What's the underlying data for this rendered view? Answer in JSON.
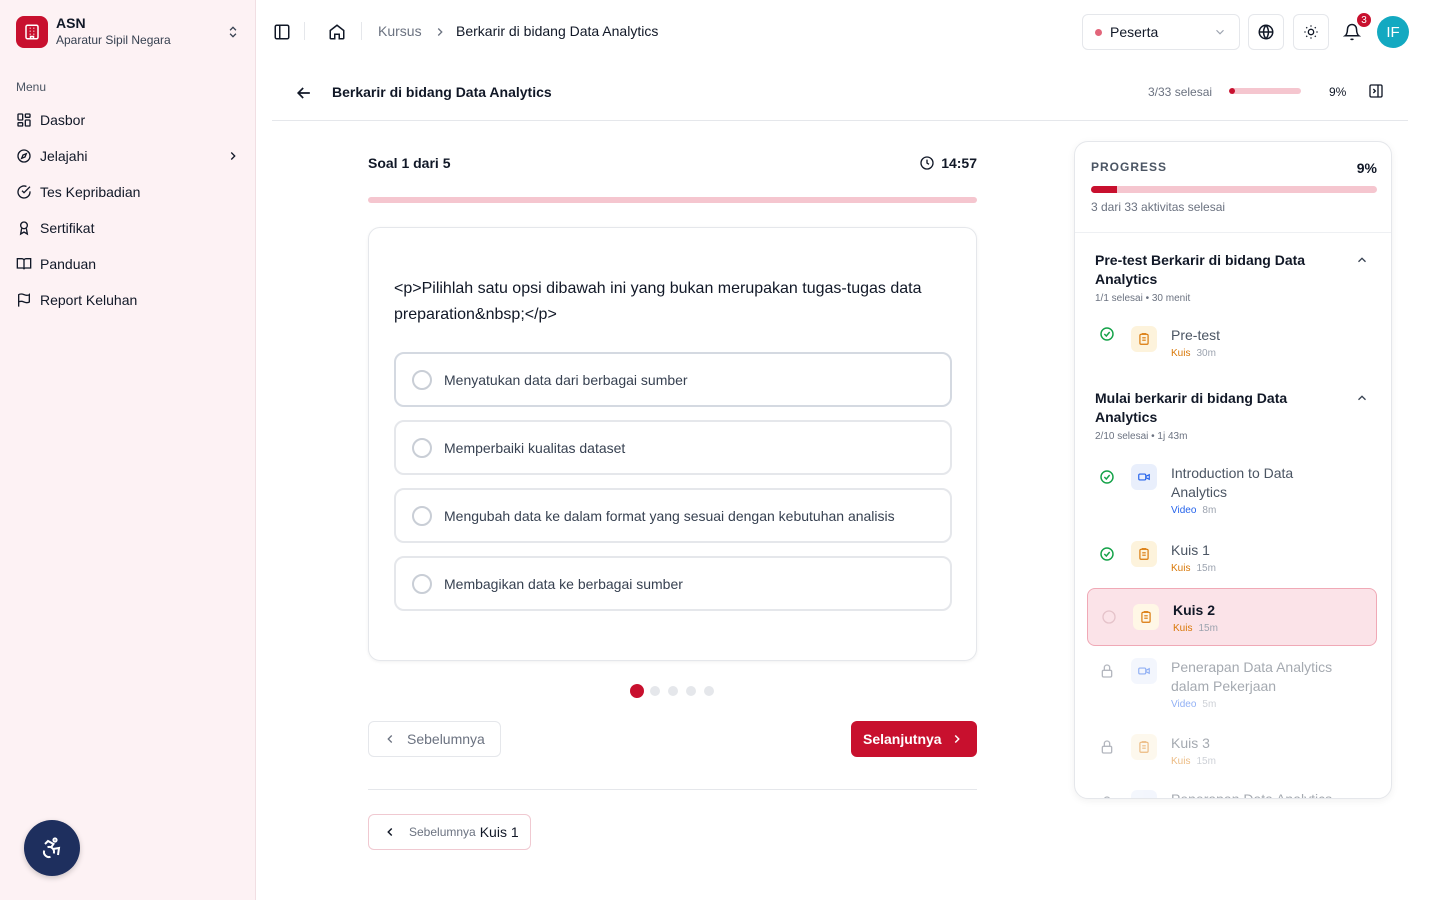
{
  "brand": {
    "name": "ASN",
    "subtitle": "Aparatur Sipil Negara"
  },
  "sidebar": {
    "menu_label": "Menu",
    "items": [
      {
        "label": "Dasbor",
        "icon": "dashboard-icon"
      },
      {
        "label": "Jelajahi",
        "icon": "compass-icon",
        "has_children": true
      },
      {
        "label": "Tes Kepribadian",
        "icon": "check-circle-icon"
      },
      {
        "label": "Sertifikat",
        "icon": "award-icon"
      },
      {
        "label": "Panduan",
        "icon": "book-open-icon"
      },
      {
        "label": "Report Keluhan",
        "icon": "flag-icon"
      }
    ]
  },
  "topbar": {
    "breadcrumb": [
      "Kursus",
      "Berkarir di bidang Data Analytics"
    ],
    "role": "Peserta",
    "notifications": "3",
    "avatar_initials": "IF"
  },
  "course": {
    "title": "Berkarir di bidang Data Analytics",
    "done_text": "3/33 selesai",
    "progress": 0.09,
    "progress_pct": "9%"
  },
  "quiz": {
    "question_counter": "Soal 1 dari 5",
    "timer": "14:57",
    "progress": 0.0,
    "question": "<p>Pilihlah satu opsi dibawah ini yang bukan merupakan tugas-tugas data preparation&nbsp;</p>",
    "options": [
      "Menyatukan data dari berbagai sumber",
      "Memperbaiki kualitas dataset",
      "Mengubah data ke dalam format yang sesuai dengan kebutuhan analisis",
      "Membagikan data ke berbagai sumber"
    ],
    "total_questions": 5,
    "current_index": 0,
    "prev_label": "Sebelumnya",
    "next_label": "Selanjutnya"
  },
  "prev_lesson": {
    "small": "Sebelumnya",
    "name": "Kuis 1"
  },
  "panel": {
    "label": "PROGRESS",
    "pct": "9%",
    "progress": 0.09,
    "sub": "3 dari 33 aktivitas selesai",
    "sections": [
      {
        "title": "Pre-test Berkarir di bidang Data Analytics",
        "meta_done": "1/1 selesai",
        "meta_time": "• 30 menit",
        "items": [
          {
            "name": "Pre-test",
            "type": "Kuis",
            "duration": "30m",
            "status": "done"
          }
        ]
      },
      {
        "title": "Mulai berkarir di bidang Data Analytics",
        "meta_done": "2/10 selesai",
        "meta_time": "• 1j 43m",
        "items": [
          {
            "name": "Introduction to Data Analytics",
            "type": "Video",
            "duration": "8m",
            "status": "done"
          },
          {
            "name": "Kuis 1",
            "type": "Kuis",
            "duration": "15m",
            "status": "done"
          },
          {
            "name": "Kuis 2",
            "type": "Kuis",
            "duration": "15m",
            "status": "current"
          },
          {
            "name": "Penerapan Data Analytics dalam Pekerjaan",
            "type": "Video",
            "duration": "5m",
            "status": "locked"
          },
          {
            "name": "Kuis 3",
            "type": "Kuis",
            "duration": "15m",
            "status": "locked"
          },
          {
            "name": "Penerapan Data Analytics",
            "type": "Video",
            "duration": "",
            "status": "locked"
          }
        ]
      }
    ]
  },
  "colors": {
    "primary": "#c8102e",
    "sidebar_bg": "#fdf2f4",
    "avatar": "#13a9c1",
    "a11y": "#1e2f5e"
  }
}
